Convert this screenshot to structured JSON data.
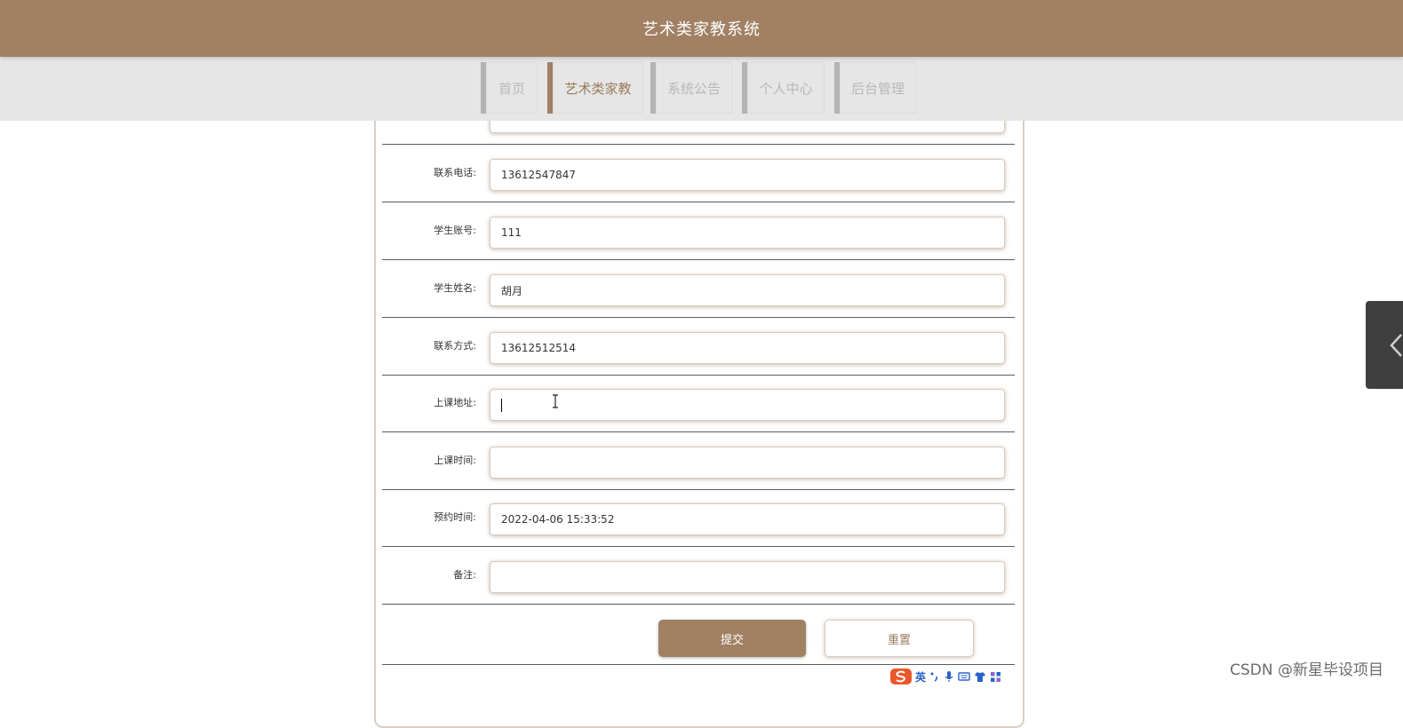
{
  "app_title": "艺术类家教系统",
  "nav": {
    "items": [
      {
        "label": "首页",
        "active": false
      },
      {
        "label": "艺术类家教",
        "active": true
      },
      {
        "label": "系统公告",
        "active": false
      },
      {
        "label": "个人中心",
        "active": false
      },
      {
        "label": "后台管理",
        "active": false
      }
    ]
  },
  "form": {
    "fields": [
      {
        "label": "联系电话:",
        "value": "13612547847"
      },
      {
        "label": "学生账号:",
        "value": "111"
      },
      {
        "label": "学生姓名:",
        "value": "胡月"
      },
      {
        "label": "联系方式:",
        "value": "13612512514"
      },
      {
        "label": "上课地址:",
        "value": ""
      },
      {
        "label": "上课时间:",
        "value": ""
      },
      {
        "label": "预约时间:",
        "value": "2022-04-06 15:33:52"
      },
      {
        "label": "备注:",
        "value": ""
      }
    ],
    "submit_label": "提交",
    "reset_label": "重置"
  },
  "ime_toolbar": {
    "mode": "英"
  },
  "watermark": "CSDN @新星毕设项目",
  "colors": {
    "brand": "#a18064",
    "nav_bg": "#e6e6e6",
    "side_tab": "#3f3f3f"
  }
}
